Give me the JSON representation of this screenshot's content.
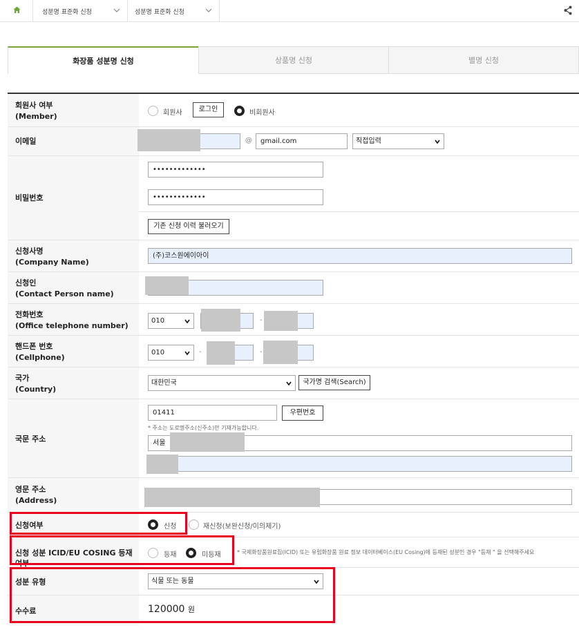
{
  "breadcrumb": {
    "crumb1": "성분명 표준화 신청",
    "crumb2": "성분명 표준화 신청"
  },
  "tabs": [
    {
      "label": "화장품 성분명 신청",
      "active": true
    },
    {
      "label": "상품명 신청",
      "active": false
    },
    {
      "label": "별명 신청",
      "active": false
    }
  ],
  "form": {
    "member": {
      "label1": "회원사 여부",
      "label2": "(Member)",
      "option_member": "회원사",
      "login_button": "로그인",
      "option_nonmember": "비회원사",
      "selected": "비회원사"
    },
    "email": {
      "label": "이메일",
      "at": "@",
      "domain": "gmail.com",
      "domain_select": "직접입력"
    },
    "password": {
      "label": "비밀번호",
      "value1": "•••••••••••••",
      "value2": "•••••••••••••",
      "load_button": "기존 신청 이력 불러오기"
    },
    "company": {
      "label1": "신청사명",
      "label2": "(Company Name)",
      "value": "(주)코스원에이아이"
    },
    "contact": {
      "label1": "신청인",
      "label2": "(Contact Person name)"
    },
    "office_phone": {
      "label1": "전화번호",
      "label2": "(Office telephone number)",
      "prefix": "010",
      "dash": "-"
    },
    "cellphone": {
      "label1": "핸드폰 번호",
      "label2": "(Cellphone)",
      "prefix": "010",
      "dash": "-"
    },
    "country": {
      "label1": "국가",
      "label2": "(Country)",
      "value": "대한민국",
      "search_button": "국가명 검색(Search)"
    },
    "kr_address": {
      "label": "국문 주소",
      "zip": "01411",
      "zip_button": "우편번호",
      "note": "* 주소는 도로명주소(신주소)만 기재가능합니다.",
      "addr1_prefix": "서울"
    },
    "en_address": {
      "label1": "영문 주소",
      "label2": "(Address)"
    },
    "apply_type": {
      "label": "신청여부",
      "option_new": "신청",
      "option_re": "재신청(보완신청/이의제기)",
      "selected": "신청"
    },
    "cosing": {
      "label": "신청 성분 ICID/EU COSING 등재 여부",
      "option_listed": "등재",
      "option_unlisted": "미등재",
      "selected": "미등재",
      "note": "* 국제화장품원료집(ICID) 또는 유럽화장품 원료 정보 데이터베이스(EU Cosing)에 등재된 성분인 경우 \"등재 \" 을 선택해주세요"
    },
    "ingredient_type": {
      "label": "성분 유형",
      "value": "식물 또는 동물"
    },
    "fee": {
      "label": "수수료",
      "amount": "120000",
      "unit": "원"
    }
  },
  "colors": {
    "accent_green": "#7aa33a",
    "highlight_red": "#e8001c",
    "autofill_blue": "#e8f0fe"
  }
}
